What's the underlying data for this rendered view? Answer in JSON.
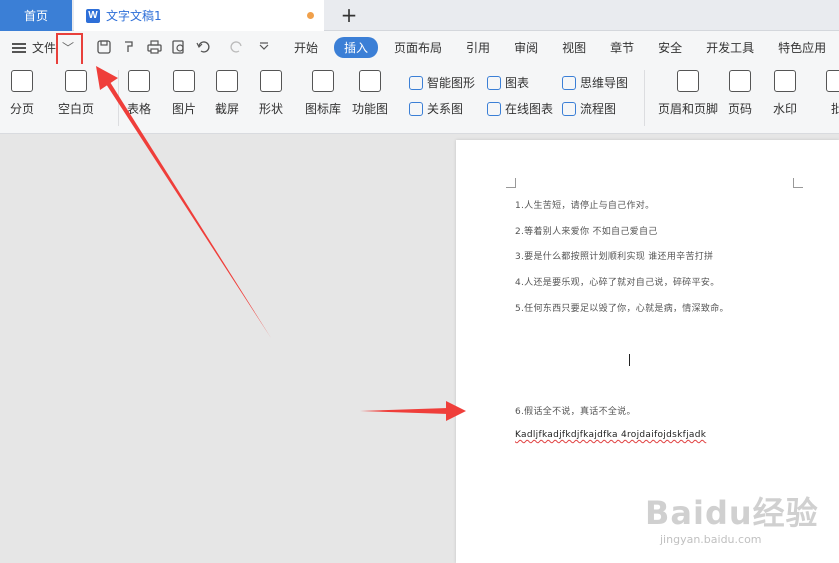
{
  "tabs": {
    "home": "首页",
    "doc_icon": "W",
    "doc_title": "文字文稿1",
    "new_tab": "+"
  },
  "menu": {
    "file": "文件",
    "chevron": "﹀",
    "items": [
      "开始",
      "插入",
      "页面布局",
      "引用",
      "审阅",
      "视图",
      "章节",
      "安全",
      "开发工具",
      "特色应用"
    ],
    "active_index": 1
  },
  "ribbon": {
    "big": [
      {
        "label": "分页",
        "icon": "page-break-icon"
      },
      {
        "label": "空白页",
        "icon": "blank-page-icon"
      },
      {
        "label": "表格",
        "icon": "table-icon"
      },
      {
        "label": "图片",
        "icon": "picture-icon"
      },
      {
        "label": "截屏",
        "icon": "screenshot-icon"
      },
      {
        "label": "形状",
        "icon": "shape-icon"
      },
      {
        "label": "图标库",
        "icon": "icon-library-icon"
      },
      {
        "label": "功能图",
        "icon": "function-chart-icon"
      },
      {
        "label": "页眉和页脚",
        "icon": "header-footer-icon"
      },
      {
        "label": "页码",
        "icon": "page-number-icon"
      },
      {
        "label": "水印",
        "icon": "watermark-icon"
      },
      {
        "label": "批",
        "icon": "comment-icon"
      }
    ],
    "small": [
      {
        "label": "智能图形",
        "icon": "smart-graphic-icon"
      },
      {
        "label": "关系图",
        "icon": "relation-chart-icon"
      },
      {
        "label": "图表",
        "icon": "chart-icon"
      },
      {
        "label": "在线图表",
        "icon": "online-chart-icon"
      },
      {
        "label": "思维导图",
        "icon": "mind-map-icon"
      },
      {
        "label": "流程图",
        "icon": "flowchart-icon"
      }
    ]
  },
  "document": {
    "lines": [
      "1.人生苦短，请停止与自己作对。",
      "2.等着别人来爱你 不如自己爱自己",
      "3.要是什么都按照计划顺利实现 谁还用辛苦打拼",
      "4.人还是要乐观，心碎了就对自己说，碎碎平安。",
      "5.任何东西只要足以毁了你，心就是病，情深致命。",
      "6.假话全不说，真话不全说。",
      "Kadljfkadjfkdjfkajdfka 4rojdaifojdskfjadk"
    ]
  },
  "watermark": {
    "brand": "Baidu经验",
    "url": "jingyan.baidu.com"
  }
}
